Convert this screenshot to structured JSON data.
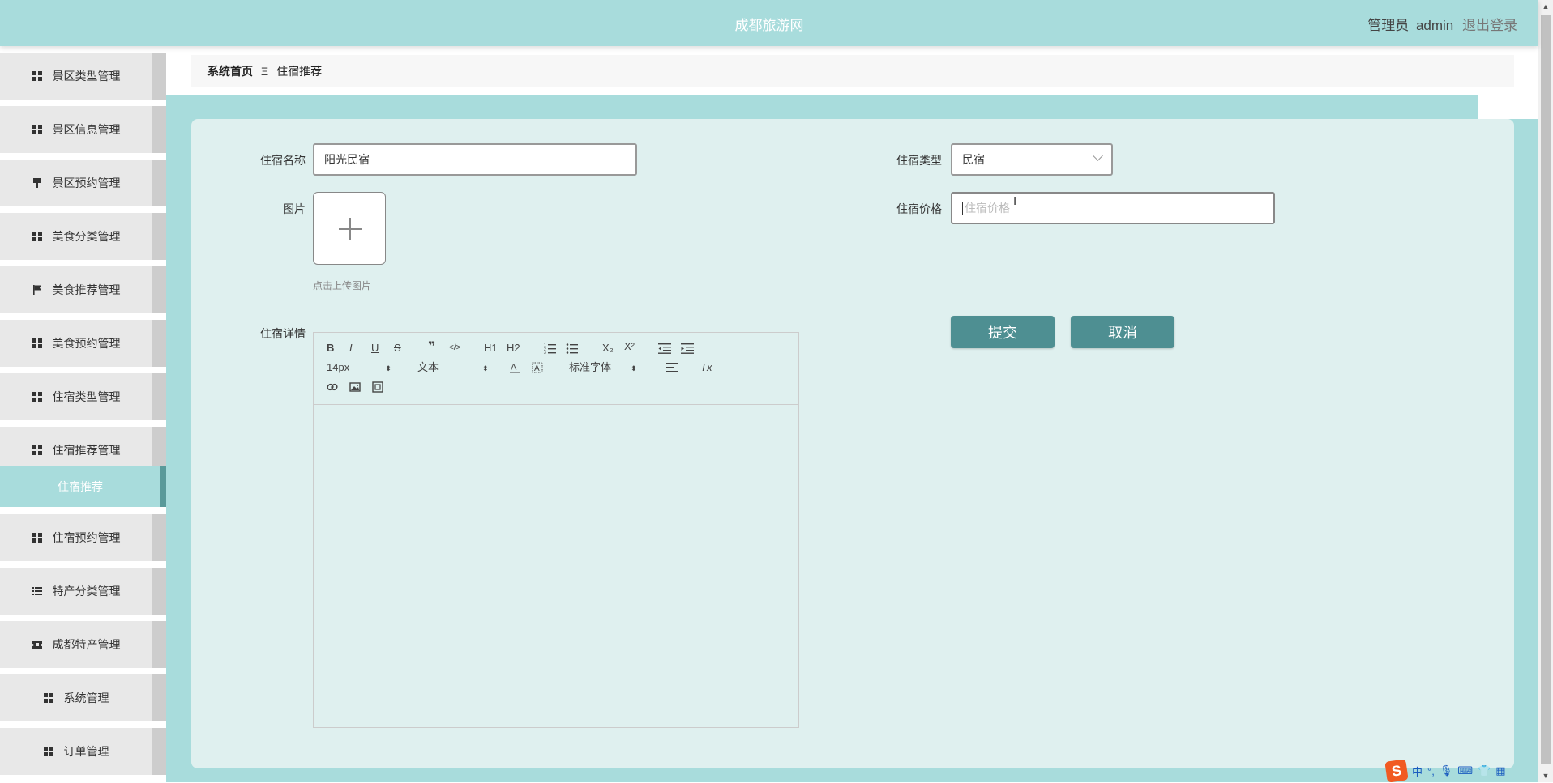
{
  "header": {
    "title": "成都旅游网",
    "role": "管理员",
    "username": "admin",
    "logout": "退出登录"
  },
  "breadcrumb": {
    "home": "系统首页",
    "separator": "Ξ",
    "current": "住宿推荐"
  },
  "sidebar": {
    "items": [
      {
        "label": "景区类型管理",
        "icon": "grid-icon"
      },
      {
        "label": "景区信息管理",
        "icon": "grid-icon"
      },
      {
        "label": "景区预约管理",
        "icon": "brush-icon"
      },
      {
        "label": "美食分类管理",
        "icon": "grid-icon"
      },
      {
        "label": "美食推荐管理",
        "icon": "flag-icon"
      },
      {
        "label": "美食预约管理",
        "icon": "grid-icon"
      },
      {
        "label": "住宿类型管理",
        "icon": "grid-icon"
      },
      {
        "label": "住宿推荐管理",
        "icon": "grid-icon"
      },
      {
        "label": "住宿预约管理",
        "icon": "grid-icon"
      },
      {
        "label": "特产分类管理",
        "icon": "list-icon"
      },
      {
        "label": "成都特产管理",
        "icon": "ticket-icon"
      },
      {
        "label": "系统管理",
        "icon": "grid-icon"
      },
      {
        "label": "订单管理",
        "icon": "grid-icon"
      }
    ],
    "active_sub": "住宿推荐"
  },
  "form": {
    "name_label": "住宿名称",
    "name_value": "阳光民宿",
    "type_label": "住宿类型",
    "type_value": "民宿",
    "image_label": "图片",
    "upload_hint": "点击上传图片",
    "price_label": "住宿价格",
    "price_placeholder": "住宿价格",
    "detail_label": "住宿详情",
    "submit": "提交",
    "cancel": "取消"
  },
  "editor_toolbar": {
    "bold": "B",
    "italic": "I",
    "underline": "U",
    "strike": "S",
    "blockquote": "❞",
    "code": "</>",
    "h1": "H1",
    "h2": "H2",
    "subscript": "X₂",
    "superscript": "X²",
    "font_size": "14px",
    "text_type": "文本",
    "font_family": "标准字体",
    "clear": "Tx"
  },
  "ime": {
    "lang": "中"
  }
}
